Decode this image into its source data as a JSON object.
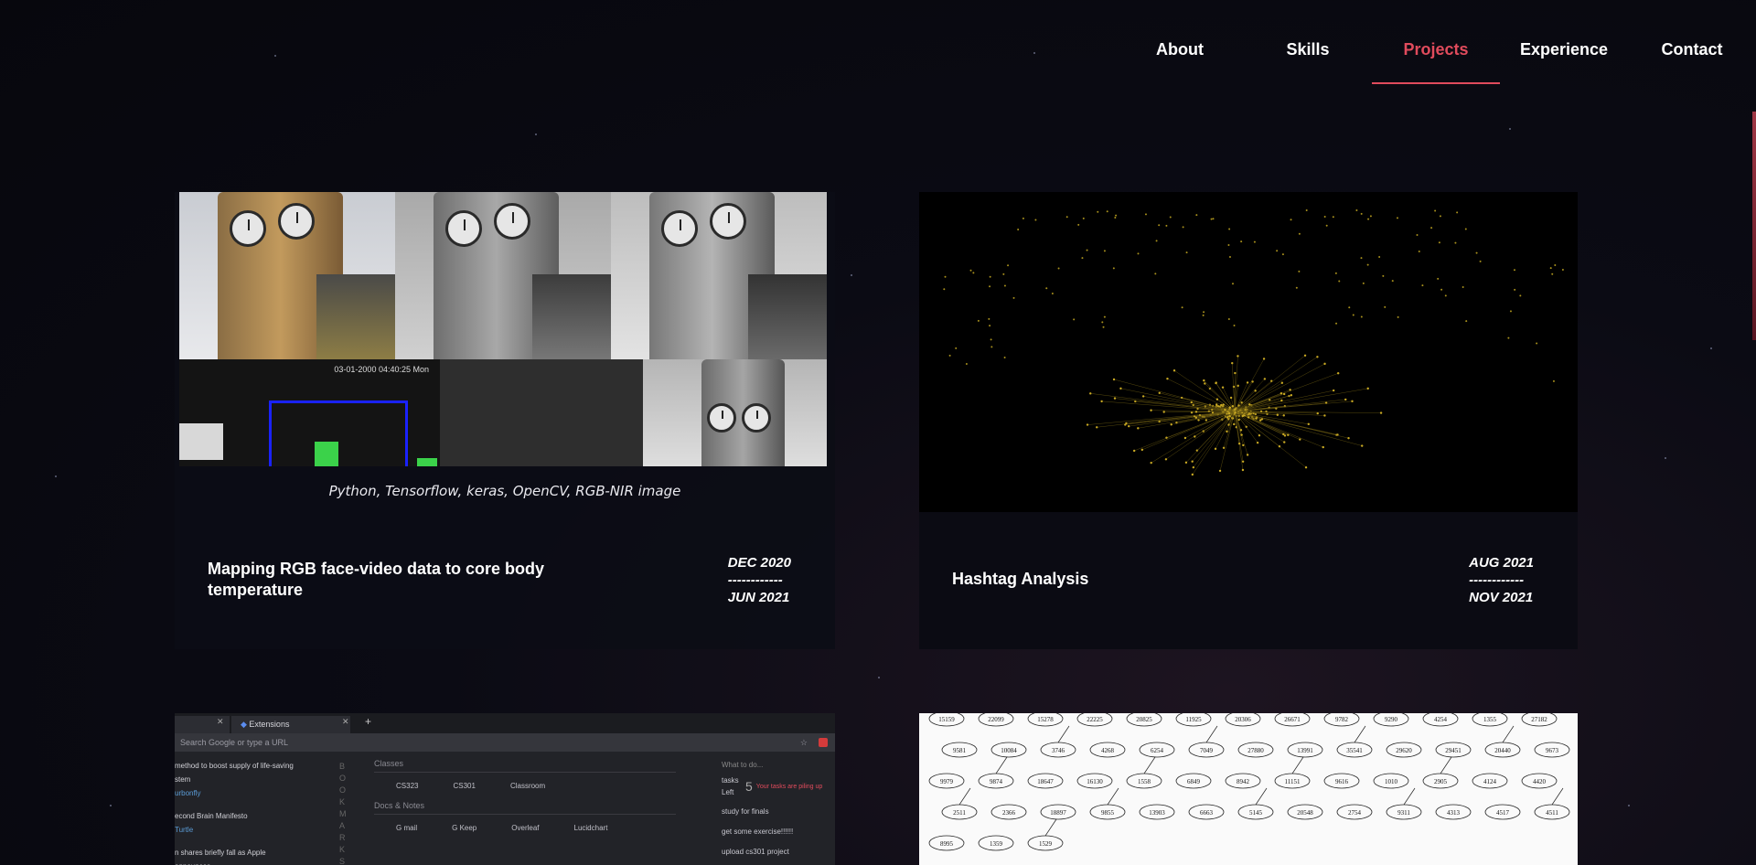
{
  "nav": {
    "items": [
      {
        "label": "About",
        "active": false
      },
      {
        "label": "Skills",
        "active": false
      },
      {
        "label": "Projects",
        "active": true
      },
      {
        "label": "Experience",
        "active": false
      },
      {
        "label": "Contact",
        "active": false
      }
    ],
    "accent_color": "#e04b5c"
  },
  "projects": [
    {
      "title": "Mapping RGB face-video data to core body temperature",
      "tags": "Python, Tensorflow, keras, OpenCV, RGB-NIR image",
      "date_start": "DEC 2020",
      "date_separator": "------------",
      "date_end": "JUN 2021",
      "image_overlay_text": "03-01-2000 04:40:25 Mon"
    },
    {
      "title": "Hashtag Analysis",
      "date_start": "AUG 2021",
      "date_separator": "------------",
      "date_end": "NOV 2021"
    },
    {
      "browser": {
        "tab_label": "Extensions",
        "url_placeholder": "Search Google or type a URL",
        "sidebar_items": [
          "method to boost supply of life-saving stem",
          "urbonfly",
          "econd Brain Manifesto",
          "Turtle",
          "n shares briefly fall as Apple announces"
        ],
        "sections": [
          "Classes",
          "Docs & Notes"
        ],
        "links_row1": [
          "CS323",
          "CS301",
          "Classroom"
        ],
        "links_row2": [
          "G mail",
          "G Keep",
          "Overleaf",
          "Lucidchart"
        ],
        "todo_title": "What to do...",
        "tasks_label": "tasks Left",
        "tasks_count": "5",
        "todo_alert": "Your tasks are piling up",
        "todos": [
          "study for finals",
          "get some exercise!!!!!!",
          "upload cs301 project"
        ],
        "vertical_word": "BOOKMARKS"
      }
    },
    {
      "graph_nodes": [
        "15159",
        "22099",
        "15278",
        "22225",
        "20825",
        "11925",
        "20306",
        "26671",
        "9782",
        "9290",
        "4254",
        "1355",
        "27182",
        "9581",
        "10084",
        "3746",
        "4268",
        "6254",
        "7049",
        "27880",
        "13991",
        "35541",
        "29620",
        "29451",
        "20440",
        "9673",
        "9979",
        "9874",
        "18647",
        "16130",
        "1558",
        "6849",
        "8942",
        "11151",
        "9616",
        "1010",
        "2905",
        "4124",
        "4420",
        "2511",
        "2366",
        "18897",
        "9855",
        "13903",
        "6663",
        "5145",
        "20548",
        "2754",
        "9311",
        "4313",
        "4517",
        "4511",
        "8995",
        "1359",
        "1529"
      ]
    }
  ]
}
